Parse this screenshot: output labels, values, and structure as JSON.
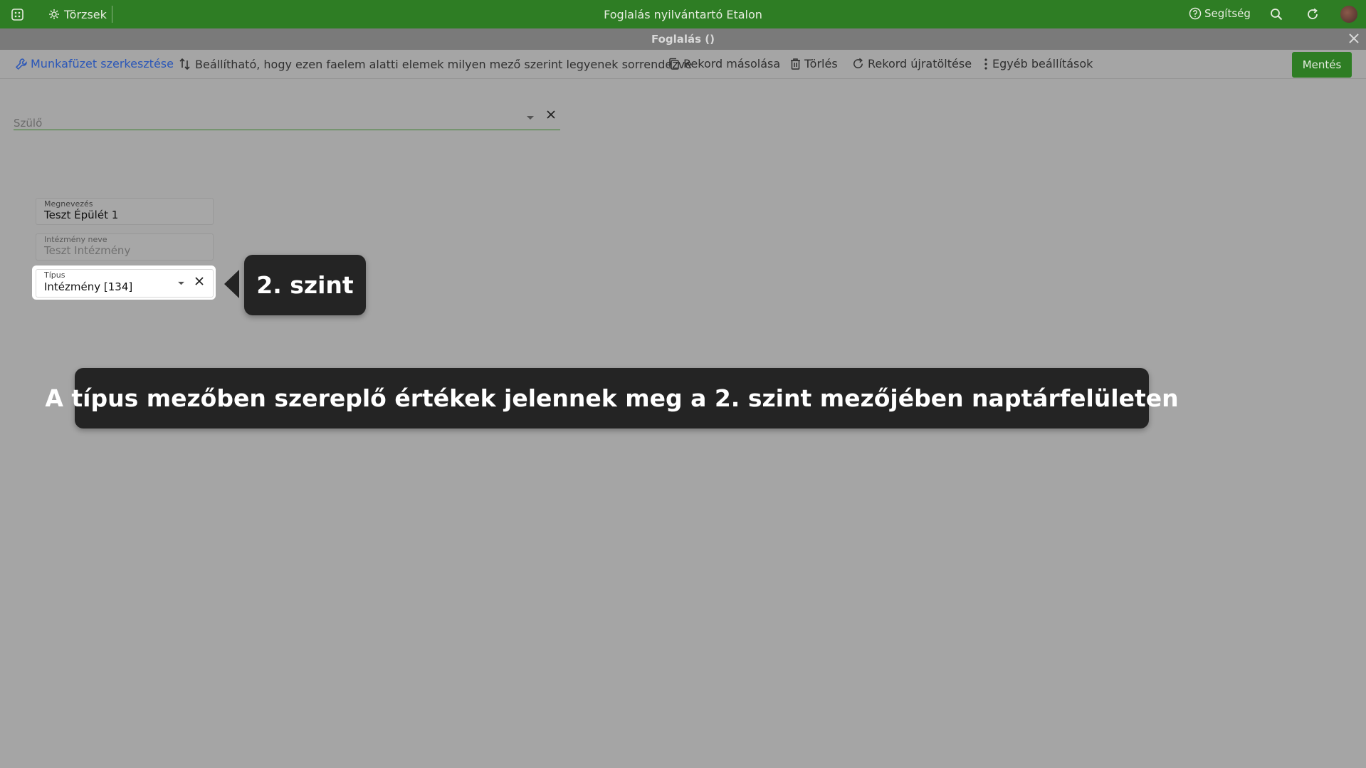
{
  "appbar": {
    "menu_label": "Törzsek",
    "title": "Foglalás nyilvántartó Etalon",
    "help_label": "Segítség",
    "bg_color": "#2e7d24"
  },
  "dialog": {
    "title": "Foglalás ()"
  },
  "toolbar": {
    "edit_workbook": "Munkafüzet szerkesztése",
    "sort_setting": "Beállítható, hogy ezen faelem alatti elemek milyen mező szerint legyenek sorrendezve",
    "copy_record": "Rekord másolása",
    "delete": "Törlés",
    "reload_record": "Rekord újratöltése",
    "other_settings": "Egyéb beállítások",
    "save": "Mentés"
  },
  "form": {
    "parent_label": "Szülő",
    "name_label": "Megnevezés",
    "name_value": "Teszt Épülét 1",
    "institution_label": "Intézmény neve",
    "institution_value": "Teszt Intézmény",
    "type_label": "Típus",
    "type_value": "Intézmény [134]"
  },
  "callouts": {
    "level": "2. szint",
    "description": "A típus mezőben szereplő értékek jelennek meg a 2. szint mezőjében naptárfelületen"
  }
}
